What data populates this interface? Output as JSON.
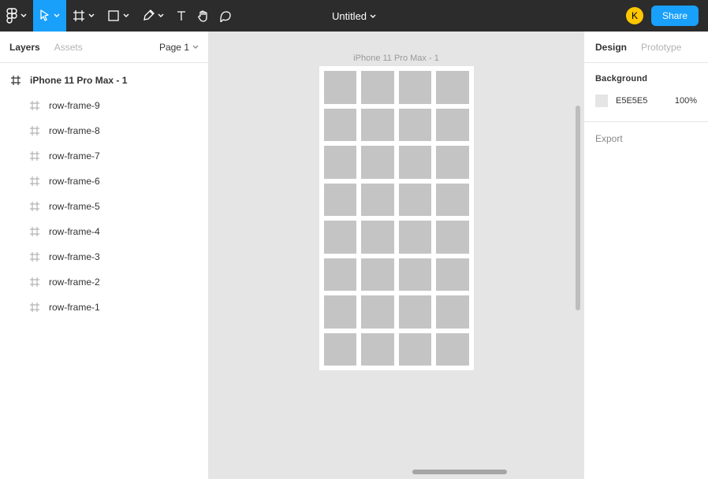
{
  "toolbar": {
    "doc_title": "Untitled",
    "avatar_initial": "K",
    "share_label": "Share"
  },
  "left": {
    "tabs": {
      "layers": "Layers",
      "assets": "Assets"
    },
    "page_selector": "Page 1",
    "root_layer": "iPhone 11 Pro Max - 1",
    "children": [
      "row-frame-9",
      "row-frame-8",
      "row-frame-7",
      "row-frame-6",
      "row-frame-5",
      "row-frame-4",
      "row-frame-3",
      "row-frame-2",
      "row-frame-1"
    ]
  },
  "canvas": {
    "artboard_label": "iPhone 11 Pro Max - 1",
    "rows": 8,
    "cols": 4
  },
  "right": {
    "tabs": {
      "design": "Design",
      "prototype": "Prototype"
    },
    "background": {
      "title": "Background",
      "hex": "E5E5E5",
      "opacity": "100%"
    },
    "export_label": "Export"
  },
  "icons": {
    "figma": "figma-logo-icon",
    "move": "move-tool-icon",
    "frame": "frame-tool-icon",
    "shape": "shape-tool-icon",
    "pen": "pen-tool-icon",
    "text": "text-tool-icon",
    "hand": "hand-tool-icon",
    "comment": "comment-tool-icon"
  }
}
